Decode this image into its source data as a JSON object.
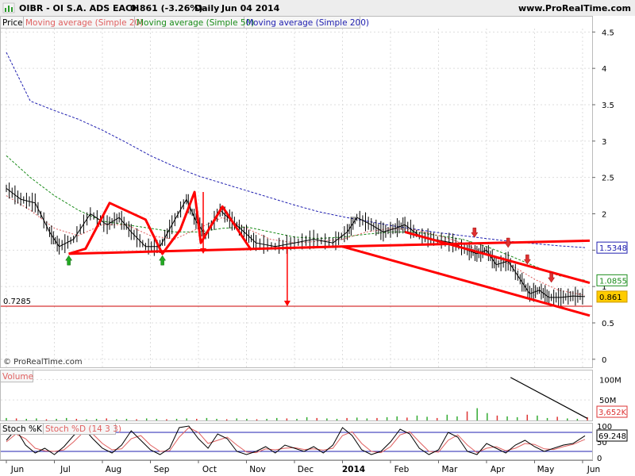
{
  "header": {
    "symbol": "OIBR - OI S.A. ADS EACH",
    "price_change": "0.861 (-3.26%)",
    "period": "Daily",
    "date": "Jun 04 2014",
    "site": "www.ProRealTime.com",
    "copyright": "© ProRealTime.com"
  },
  "legends": {
    "price": "Price",
    "sma20": "Moving average (Simple 20)",
    "sma50": "Moving average (Simple 50)",
    "sma200": "Moving average (Simple 200)",
    "volume": "Volume",
    "stoch_k": "Stoch %K",
    "stoch_d": "Stoch %D (14 3 3)"
  },
  "colors": {
    "price": "#000000",
    "sma20": "#e06060",
    "sma50": "#1a8c1a",
    "sma200": "#2020b0",
    "annotation": "#ff0000",
    "up_arrow": "#22aa22",
    "down_arrow": "#e03030",
    "header_bg": "#ededed"
  },
  "chart_data": {
    "type": "line",
    "x_axis": {
      "labels": [
        "Jun",
        "Jul",
        "Aug",
        "Sep",
        "Oct",
        "Nov",
        "Dec",
        "2014",
        "Feb",
        "Mar",
        "Apr",
        "May",
        "Jun"
      ],
      "positions": [
        0,
        1,
        2,
        3,
        4,
        5,
        6,
        7,
        8,
        9,
        10,
        11,
        12
      ]
    },
    "price_panel": {
      "ylim": [
        -0.1,
        4.7
      ],
      "y_ticks": [
        "4.5",
        "4",
        "3.5",
        "3",
        "2.5",
        "2",
        "1.5",
        "1",
        "0.5",
        "0"
      ],
      "y_tick_values": [
        4.5,
        4,
        3.5,
        3,
        2.5,
        2,
        1.5,
        1,
        0.5,
        0
      ],
      "value_badges": {
        "sma200": "1.5348",
        "sma50": "1.0855",
        "price": "0.861"
      },
      "support_line": {
        "value": 0.7285,
        "label": "0.7285"
      },
      "series": [
        {
          "name": "Price",
          "x": [
            0,
            0.3,
            0.6,
            0.9,
            1.1,
            1.4,
            1.75,
            2.1,
            2.35,
            2.6,
            2.9,
            3.2,
            3.45,
            3.75,
            3.95,
            4.15,
            4.45,
            4.7,
            4.95,
            5.2,
            5.6,
            6,
            6.4,
            6.8,
            7.1,
            7.3,
            7.6,
            7.85,
            8.1,
            8.3,
            8.6,
            8.9,
            9.3,
            9.6,
            9.8,
            10,
            10.2,
            10.45,
            10.7,
            10.9,
            11.1,
            11.3,
            11.55,
            11.8,
            12.05
          ],
          "y": [
            2.35,
            2.2,
            2.15,
            1.75,
            1.55,
            1.65,
            2.0,
            1.85,
            1.95,
            1.75,
            1.55,
            1.55,
            1.85,
            2.2,
            1.9,
            1.7,
            2.05,
            1.9,
            1.75,
            1.6,
            1.55,
            1.6,
            1.65,
            1.6,
            1.75,
            1.95,
            1.85,
            1.75,
            1.8,
            1.85,
            1.7,
            1.65,
            1.6,
            1.5,
            1.45,
            1.5,
            1.3,
            1.35,
            1.1,
            0.9,
            0.95,
            0.85,
            0.85,
            0.87,
            0.861
          ]
        },
        {
          "name": "Moving average (Simple 20)",
          "x": [
            0,
            0.5,
            1,
            1.5,
            2,
            2.5,
            3,
            3.5,
            4,
            4.5,
            5,
            5.5,
            6,
            6.5,
            7,
            7.5,
            8,
            8.5,
            9,
            9.5,
            10,
            10.5,
            11,
            11.5,
            12.05
          ],
          "y": [
            2.25,
            2.05,
            1.8,
            1.7,
            1.85,
            1.85,
            1.7,
            1.65,
            1.8,
            1.95,
            1.8,
            1.65,
            1.6,
            1.62,
            1.65,
            1.75,
            1.8,
            1.78,
            1.7,
            1.6,
            1.45,
            1.3,
            1.1,
            0.95,
            0.88
          ]
        },
        {
          "name": "Moving average (Simple 50)",
          "x": [
            0,
            0.5,
            1,
            1.5,
            2,
            2.5,
            3,
            3.5,
            4,
            4.5,
            5,
            5.5,
            6,
            6.5,
            7,
            7.5,
            8,
            8.5,
            9,
            9.5,
            10,
            10.5,
            11,
            11.5,
            12.05
          ],
          "y": [
            2.8,
            2.5,
            2.25,
            2.05,
            1.9,
            1.85,
            1.8,
            1.75,
            1.75,
            1.8,
            1.82,
            1.75,
            1.68,
            1.66,
            1.68,
            1.72,
            1.75,
            1.75,
            1.7,
            1.65,
            1.55,
            1.42,
            1.28,
            1.15,
            1.0855
          ]
        },
        {
          "name": "Moving average (Simple 200)",
          "x": [
            0,
            0.5,
            1,
            1.5,
            2,
            2.5,
            3,
            3.5,
            4,
            4.5,
            5,
            5.5,
            6,
            6.5,
            7,
            7.5,
            8,
            8.5,
            9,
            9.5,
            10,
            10.5,
            11,
            11.5,
            12.05
          ],
          "y": [
            4.22,
            3.55,
            3.42,
            3.3,
            3.15,
            2.98,
            2.8,
            2.65,
            2.52,
            2.42,
            2.32,
            2.22,
            2.12,
            2.03,
            1.96,
            1.9,
            1.84,
            1.79,
            1.74,
            1.7,
            1.66,
            1.62,
            1.59,
            1.56,
            1.5348
          ]
        }
      ],
      "annotation_lines": [
        {
          "x": [
            1.3,
            6.95,
            12.15
          ],
          "y": [
            1.45,
            1.55,
            1.63
          ]
        },
        {
          "x": [
            1.3,
            1.65,
            2.15,
            2.9,
            3.25,
            3.62,
            3.92,
            4.05,
            4.5,
            5.1
          ],
          "y": [
            1.45,
            1.52,
            2.15,
            1.92,
            1.45,
            1.78,
            2.3,
            1.6,
            2.1,
            1.5
          ]
        },
        {
          "x": [
            7.0,
            12.15
          ],
          "y": [
            1.55,
            0.6
          ]
        },
        {
          "x": [
            8.3,
            12.15
          ],
          "y": [
            1.75,
            1.05
          ]
        }
      ],
      "vertical_arrows": [
        {
          "x": 4.1,
          "from": 2.3,
          "to": 1.45
        },
        {
          "x": 5.85,
          "from": 1.55,
          "to": 0.7285
        }
      ],
      "up_markers": [
        {
          "x": 1.3,
          "y": 1.36
        },
        {
          "x": 3.25,
          "y": 1.36
        }
      ],
      "down_markers": [
        {
          "x": 9.75,
          "y": 1.72
        },
        {
          "x": 10.45,
          "y": 1.58
        },
        {
          "x": 10.85,
          "y": 1.35
        },
        {
          "x": 11.35,
          "y": 1.1
        }
      ]
    },
    "volume_panel": {
      "ylim": [
        0,
        120
      ],
      "y_ticks": [
        "100M",
        "50M"
      ],
      "y_tick_values": [
        100,
        50
      ],
      "value_badge": "3,652K",
      "bars": [
        6,
        5,
        4,
        5,
        3,
        4,
        6,
        4,
        3,
        4,
        5,
        3,
        4,
        3,
        5,
        4,
        3,
        4,
        5,
        4,
        6,
        4,
        3,
        5,
        4,
        3,
        4,
        6,
        5,
        4,
        8,
        6,
        5,
        4,
        6,
        7,
        5,
        6,
        8,
        10,
        7,
        12,
        9,
        6,
        14,
        10,
        22,
        30,
        18,
        12,
        10,
        8,
        14,
        12,
        6,
        9,
        5,
        4,
        8
      ],
      "bar_x_start": 0,
      "bar_x_end": 12.1,
      "trendline": {
        "x": [
          10.5,
          12.1
        ],
        "y": [
          105,
          5
        ]
      }
    },
    "stoch_panel": {
      "ylim": [
        -5,
        105
      ],
      "y_ticks": [
        "100",
        "50",
        "0"
      ],
      "y_tick_values": [
        100,
        50,
        0
      ],
      "levels": [
        20,
        80
      ],
      "value_badge": "69.248",
      "k": {
        "x": [
          0,
          0.2,
          0.4,
          0.6,
          0.8,
          1.0,
          1.2,
          1.4,
          1.6,
          1.8,
          2.0,
          2.2,
          2.4,
          2.6,
          2.8,
          3.0,
          3.2,
          3.4,
          3.6,
          3.8,
          4.0,
          4.2,
          4.4,
          4.6,
          4.8,
          5.0,
          5.2,
          5.4,
          5.6,
          5.8,
          6.0,
          6.2,
          6.4,
          6.6,
          6.8,
          7.0,
          7.2,
          7.4,
          7.6,
          7.8,
          8.0,
          8.2,
          8.4,
          8.6,
          8.8,
          9.0,
          9.2,
          9.4,
          9.6,
          9.8,
          10.0,
          10.2,
          10.4,
          10.6,
          10.8,
          11.0,
          11.2,
          11.4,
          11.6,
          11.8,
          12.05
        ],
        "y": [
          55,
          90,
          40,
          15,
          30,
          10,
          35,
          70,
          95,
          60,
          30,
          15,
          40,
          85,
          55,
          25,
          10,
          30,
          95,
          100,
          60,
          30,
          75,
          60,
          20,
          10,
          20,
          35,
          15,
          40,
          30,
          20,
          35,
          15,
          40,
          95,
          70,
          25,
          10,
          20,
          50,
          90,
          75,
          30,
          10,
          25,
          80,
          65,
          20,
          10,
          45,
          30,
          15,
          40,
          55,
          35,
          20,
          30,
          40,
          45,
          69.248
        ]
      },
      "d": {
        "x": [
          0,
          0.2,
          0.4,
          0.6,
          0.8,
          1.0,
          1.2,
          1.4,
          1.6,
          1.8,
          2.0,
          2.2,
          2.4,
          2.6,
          2.8,
          3.0,
          3.2,
          3.4,
          3.6,
          3.8,
          4.0,
          4.2,
          4.4,
          4.6,
          4.8,
          5.0,
          5.2,
          5.4,
          5.6,
          5.8,
          6.0,
          6.2,
          6.4,
          6.6,
          6.8,
          7.0,
          7.2,
          7.4,
          7.6,
          7.8,
          8.0,
          8.2,
          8.4,
          8.6,
          8.8,
          9.0,
          9.2,
          9.4,
          9.6,
          9.8,
          10.0,
          10.2,
          10.4,
          10.6,
          10.8,
          11.0,
          11.2,
          11.4,
          11.6,
          11.8,
          12.05
        ],
        "y": [
          50,
          75,
          60,
          30,
          22,
          20,
          25,
          50,
          80,
          75,
          45,
          25,
          28,
          60,
          70,
          40,
          20,
          22,
          65,
          95,
          80,
          45,
          55,
          65,
          40,
          18,
          16,
          28,
          25,
          30,
          32,
          26,
          28,
          24,
          30,
          70,
          82,
          45,
          20,
          16,
          35,
          72,
          82,
          50,
          20,
          18,
          55,
          72,
          40,
          16,
          30,
          35,
          22,
          30,
          45,
          42,
          28,
          26,
          35,
          42,
          58
        ]
      }
    }
  }
}
